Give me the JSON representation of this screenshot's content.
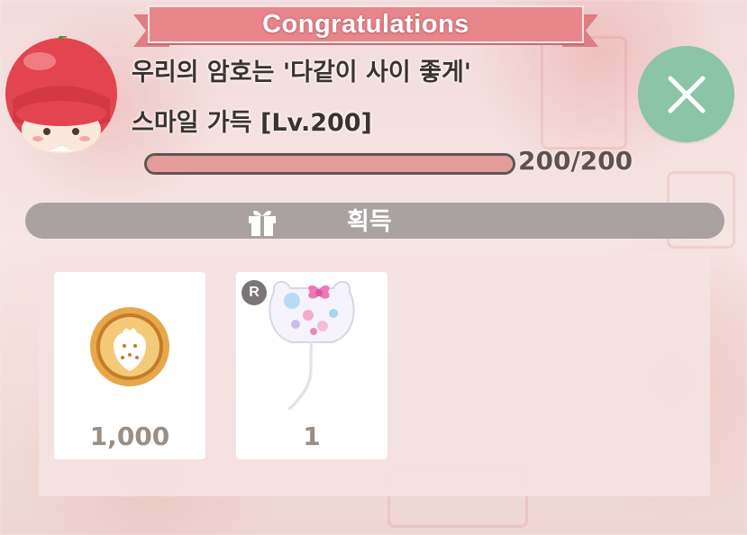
{
  "banner": {
    "text": "Congratulations"
  },
  "title": {
    "line1": "우리의 암호는 '다같이 사이 좋게'",
    "line2": "스마일 가득 [Lv.200]"
  },
  "progress": {
    "text": "200/200",
    "fraction": 1.0
  },
  "acquire": {
    "label": "획득"
  },
  "rewards": [
    {
      "icon": "strawberry-coin-icon",
      "amount": "1,000"
    },
    {
      "icon": "hello-kitty-balloon-icon",
      "amount": "1",
      "rarity": "R"
    }
  ],
  "colors": {
    "banner": "#e8868c",
    "close": "#8cc4a8",
    "progress_fill": "#e39b9b",
    "acquire_bar": "#a9a2a1"
  }
}
